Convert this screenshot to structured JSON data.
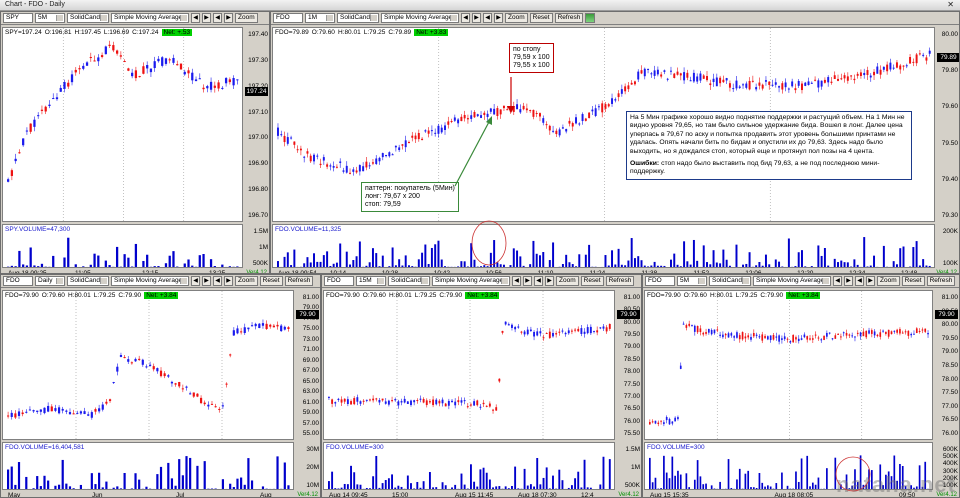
{
  "window": {
    "title": "Chart - FDO - Daily",
    "close_glyph": "✕"
  },
  "colors": {
    "up": "#1a1aee",
    "down": "#ee1111",
    "vol": "#0000cc",
    "net_bg": "#00d000",
    "zero": "#b00000"
  },
  "panes": [
    {
      "id": "spy-5m",
      "toolbar": {
        "symbol": "SPY",
        "interval": "5M",
        "style": "SolidCandle",
        "study": "Simple Moving Average",
        "zoom": "Zoom"
      },
      "ohlc": {
        "last": "SPY=197.24",
        "o": "O:196.81",
        "h": "H:197.45",
        "l": "L:196.69",
        "c": "C:197.24",
        "net": "Net: +.53"
      },
      "price_tag": "197.24",
      "volume_label": "SPY.VOLUME=47,300",
      "y_ticks": [
        "197.40",
        "197.30",
        "197.20",
        "197.10",
        "197.00",
        "196.90",
        "196.80",
        "196.70"
      ],
      "vol_ticks": [
        "1.5M",
        "1M",
        "500K"
      ],
      "x_ticks": [
        "Aug 18 09:25",
        "11:05",
        "12:15",
        "13:25"
      ],
      "version": "Ver4.12"
    },
    {
      "id": "fdo-1m",
      "toolbar": {
        "symbol": "FDO",
        "interval": "1M",
        "style": "SolidCandle",
        "study": "Simple Moving Average",
        "zoom": "Zoom",
        "reset": "Reset",
        "refresh": "Refresh"
      },
      "ohlc": {
        "last": "FDO=79.89",
        "o": "O:79.60",
        "h": "H:80.01",
        "l": "L:79.25",
        "c": "C:79.89",
        "net": "Net: +3.83"
      },
      "price_tag": "79.89",
      "volume_label": "FDO.VOLUME=11,325",
      "y_ticks": [
        "80.00",
        "79.80",
        "79.60",
        "79.50",
        "79.40",
        "79.30"
      ],
      "vol_ticks": [
        "200K",
        "100K"
      ],
      "x_ticks": [
        "Aug 18 09:54",
        "10:14",
        "10:28",
        "10:42",
        "10:56",
        "11:10",
        "11:24",
        "11:38",
        "11:52",
        "12:06",
        "12:20",
        "12:34",
        "12:48"
      ],
      "version": "Ver4.12"
    },
    {
      "id": "fdo-daily",
      "toolbar": {
        "symbol": "FDO",
        "interval": "Daily",
        "style": "SolidCandle",
        "study": "Simple Moving Average",
        "zoom": "Zoom",
        "reset": "Reset",
        "refresh": "Refresh"
      },
      "ohlc": {
        "last": "FDO=79.90",
        "o": "O:79.60",
        "h": "H:80.01",
        "l": "L:79.25",
        "c": "C:79.90",
        "net": "Net: +3.84"
      },
      "price_tag": "79.90",
      "volume_label": "FDO.VOLUME=16,404,581",
      "y_ticks": [
        "81.00",
        "79.00",
        "77.00",
        "75.00",
        "73.00",
        "71.00",
        "69.00",
        "67.00",
        "65.00",
        "63.00",
        "61.00",
        "59.00",
        "57.00",
        "55.00"
      ],
      "vol_ticks": [
        "30M",
        "20M",
        "10M"
      ],
      "x_ticks": [
        "May",
        "Jun",
        "Jul",
        "Aug"
      ],
      "version": "Ver4.12"
    },
    {
      "id": "fdo-15m",
      "toolbar": {
        "symbol": "FDO",
        "interval": "15M",
        "style": "SolidCandle",
        "study": "Simple Moving Average",
        "zoom": "Zoom",
        "reset": "Reset",
        "refresh": "Refresh"
      },
      "ohlc": {
        "last": "FDO=79.90",
        "o": "O:79.60",
        "h": "H:80.01",
        "l": "L:79.25",
        "c": "C:79.90",
        "net": "Net: +3.84"
      },
      "price_tag": "79.90",
      "volume_label": "FDO.VOLUME=300",
      "y_ticks": [
        "81.00",
        "80.50",
        "80.00",
        "79.50",
        "79.00",
        "78.50",
        "78.00",
        "77.50",
        "77.00",
        "76.50",
        "76.00",
        "75.50"
      ],
      "vol_ticks": [
        "1.5M",
        "1M",
        "500K"
      ],
      "x_ticks": [
        "Aug 14 09:45",
        "15:00",
        "Aug 15 11:45",
        "Aug 18 07:30",
        "12:4"
      ],
      "version": "Ver4.12"
    },
    {
      "id": "fdo-5m",
      "toolbar": {
        "symbol": "FDO",
        "interval": "5M",
        "style": "SolidCandle",
        "study": "Simple Moving Average",
        "zoom": "Zoom",
        "reset": "Reset",
        "refresh": "Refresh"
      },
      "ohlc": {
        "last": "FDO=79.90",
        "o": "O:79.60",
        "h": "H:80.01",
        "l": "L:79.25",
        "c": "C:79.90",
        "net": "Net: +3.84"
      },
      "price_tag": "79.90",
      "volume_label": "FDO.VOLUME=300",
      "y_ticks": [
        "81.00",
        "80.50",
        "80.00",
        "79.50",
        "79.00",
        "78.50",
        "78.00",
        "77.50",
        "77.00",
        "76.50",
        "76.00"
      ],
      "vol_ticks": [
        "600K",
        "500K",
        "400K",
        "300K",
        "200K",
        "100K"
      ],
      "x_ticks": [
        "Aug 15 15:35",
        "Aug 18 08:05",
        "09:50"
      ],
      "version": "Ver4.12"
    }
  ],
  "annotations": {
    "stop": [
      "по стопу",
      "79,59 x 100",
      "79,55 x 100"
    ],
    "entry": [
      "паттерн: покупатель (5Мин)",
      "лонг: 79,67 x 200",
      "стоп: 79,59"
    ],
    "comment": [
      "На 5 Мин графике хорошо видно поднятие поддержки и растущий объем. На 1 Мин не видно уровня 79,65, но там было сильное удержание бида. Вошел в лонг. Далее цена уперлась в 79,67 по аску и попытка продавить этот уровень большими принтами не удалась. Опять начали бить по бидам и опустили их до 79,63. Здесь надо было выходить, но я дождался стоп, который еще и протянул пол позы на 4 цента."
    ],
    "errors_label": "Ошибки:",
    "errors_text": " стоп надо было выставить под бид 79,63, а не под последнюю мини-поддержку."
  },
  "watermark": "nataha.net"
}
